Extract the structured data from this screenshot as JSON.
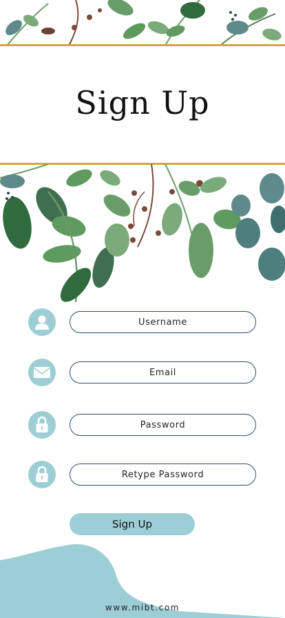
{
  "header": {
    "title": "Sign Up"
  },
  "form": {
    "fields": [
      {
        "name": "username",
        "placeholder": "Username",
        "icon": "user-icon"
      },
      {
        "name": "email",
        "placeholder": "Email",
        "icon": "envelope-icon"
      },
      {
        "name": "password",
        "placeholder": "Password",
        "icon": "lock-icon"
      },
      {
        "name": "retype-password",
        "placeholder": "Retype Password",
        "icon": "lock-icon"
      }
    ],
    "submit_label": "Sign Up"
  },
  "footer": {
    "website": "www.mibt.com"
  },
  "colors": {
    "accent": "#9dced5",
    "gold": "#d4a63c",
    "border": "#2e4a7a",
    "leaf_dark": "#2f6b3c",
    "leaf_mid": "#5f9a5f",
    "leaf_teal": "#5f8a8a",
    "stem_brown": "#7a4a38"
  }
}
